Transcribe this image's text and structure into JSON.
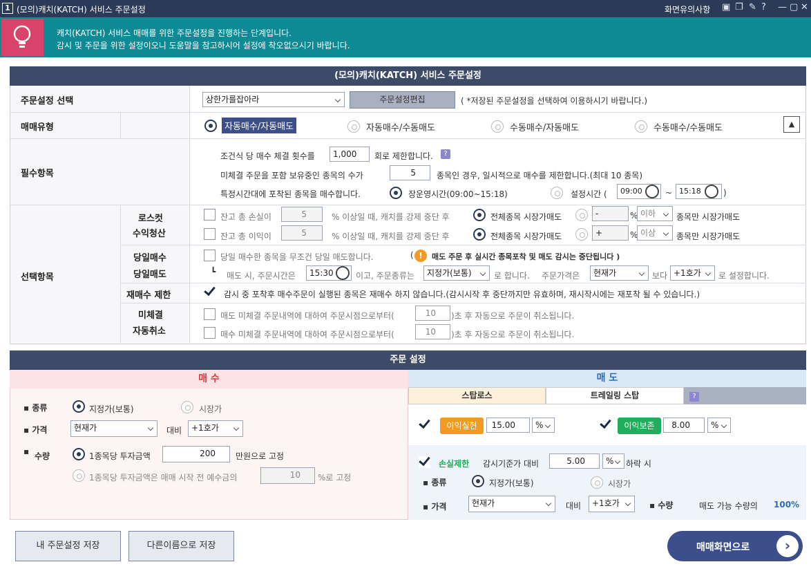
{
  "titlebar": {
    "num": "1",
    "title": "(모의)캐치(KATCH) 서비스 주문설정",
    "note": "화면유의사항",
    "help": "?"
  },
  "banner": {
    "line1": "캐치(KATCH) 서비스 매매를 위한 주문설정을 진행하는 단계입니다.",
    "line2": "감시 및 주문을 위한 설정이오니 도움말을 참고하시어 설정에 착오없으시기 바랍니다."
  },
  "top": {
    "header": "(모의)캐치(KATCH) 서비스 주문설정",
    "order_select": {
      "label": "주문설정 선택",
      "value": "상한가를잡아라",
      "edit": "주문설정편집",
      "hint": "( *저장된 주문설정을 선택하여 이용하시기 바랍니다.)"
    },
    "trade_type": {
      "label": "매매유형",
      "options": [
        "자동매수/자동매도",
        "자동매수/수동매도",
        "수동매수/자동매도",
        "수동매수/수동매도"
      ]
    },
    "required": {
      "label": "필수항목",
      "r1a": "조건식 당 매수 체결 횟수를",
      "r1v": "1,000",
      "r1b": "회로 제한합니다.",
      "r2a": "미체결 주문을 포함 보유중인 종목의 수가",
      "r2v": "5",
      "r2b": "종목인 경우, 일시적으로 매수를 제한합니다.(최대 10 종목)",
      "r3a": "특정시간대에 포착된 종목을 매수합니다.",
      "r3opt1": "장운영시간(09:00~15:18)",
      "r3opt2": "설정시간 (",
      "t1": "09:00",
      "tilde": "~",
      "t2": "15:18",
      "close": ")"
    },
    "optional": {
      "label": "선택항목",
      "losscut1": "로스컷",
      "losscut2": "수익청산",
      "lc1a": "잔고 총 손실이",
      "lc1v": "5",
      "lc1b": "% 이상일 때, 캐치를 강제 중단 후",
      "lc1c": "전체종목 시장가매도",
      "lc1sign": "-",
      "lc1pct": "%",
      "lc1cmp": "이하",
      "lc1d": "종목만 시장가매도",
      "lc2a": "잔고 총 이익이",
      "lc2v": "5",
      "lc2b": "% 이상일 때, 캐치를 강제 중단 후",
      "lc2c": "전체종목 시장가매도",
      "lc2sign": "+",
      "lc2pct": "%",
      "lc2cmp": "이상",
      "lc2d": "종목만 시장가매도",
      "day1": "당일매수",
      "day2": "당일매도",
      "d1": "당일 매수한 종목을 무조건 당일 매도합니다.",
      "d1note": "매도 주문 후 실시간 종목포착 및 매도 감시는 중단됩니다 )",
      "d1open": "(",
      "d2a": "매도 시, 주문시간은",
      "d2t": "15:30",
      "d2b": "이고, 주문종류는",
      "d2k": "지정가(보통)",
      "d2c": "로 합니다.",
      "d2d": "주문가격은",
      "d2p": "현재가",
      "d2e": "보다",
      "d2h": "+1호가",
      "d2f": "로 설정합니다.",
      "rebuy": "재매수 제한",
      "rb": "감시 중 포착후 매수주문이 실행된 종목은 재매수 하지 않습니다.(감시시작 후 중단까지만 유효하며, 재시작시에는 재포착 될 수 있습니다.)",
      "unf1": "미체결",
      "unf2": "자동취소",
      "u1a": "매도 미체결 주문내역에 대하여 주문시점으로부터(",
      "u1v": "10",
      "u1b": ")초 후 자동으로 주문이 취소됩니다.",
      "u2a": "매수 미체결 주문내역에 대하여 주문시점으로부터(",
      "u2v": "10",
      "u2b": ")초 후 자동으로 주문이 취소됩니다."
    }
  },
  "order": {
    "header": "주문 설정",
    "buy": {
      "title": "매 수",
      "kind": "종류",
      "k1": "지정가(보통)",
      "k2": "시장가",
      "price": "가격",
      "pv": "현재가",
      "vs": "대비",
      "ph": "+1호가",
      "qty": "수량",
      "q1": "1종목당 투자금액",
      "q1v": "200",
      "q1b": "만원으로 고정",
      "q2": "1종목당 투자금액은 매매 시작 전 예수금의",
      "q2v": "10",
      "q2b": "%로 고정"
    },
    "sell": {
      "title": "매 도",
      "tab1": "스탑로스",
      "tab2": "트레일링 스탑",
      "profit": "이익실현",
      "pv": "15.00",
      "pu": "%",
      "keep": "이익보존",
      "kv": "8.00",
      "ku": "%",
      "loss": "손실제한",
      "lb": "감시기준가 대비",
      "lv": "5.00",
      "lu": "%",
      "lc": "하락 시",
      "kind": "종류",
      "k1": "지정가(보통)",
      "k2": "시장가",
      "price": "가격",
      "pp": "현재가",
      "vs": "대비",
      "ph": "+1호가",
      "qty": "수량",
      "qt": "매도 가능 수량의",
      "qv": "100%"
    }
  },
  "footer": {
    "save": "내 주문설정 저장",
    "saveas": "다른이름으로 저장",
    "go": "매매화면으로"
  }
}
